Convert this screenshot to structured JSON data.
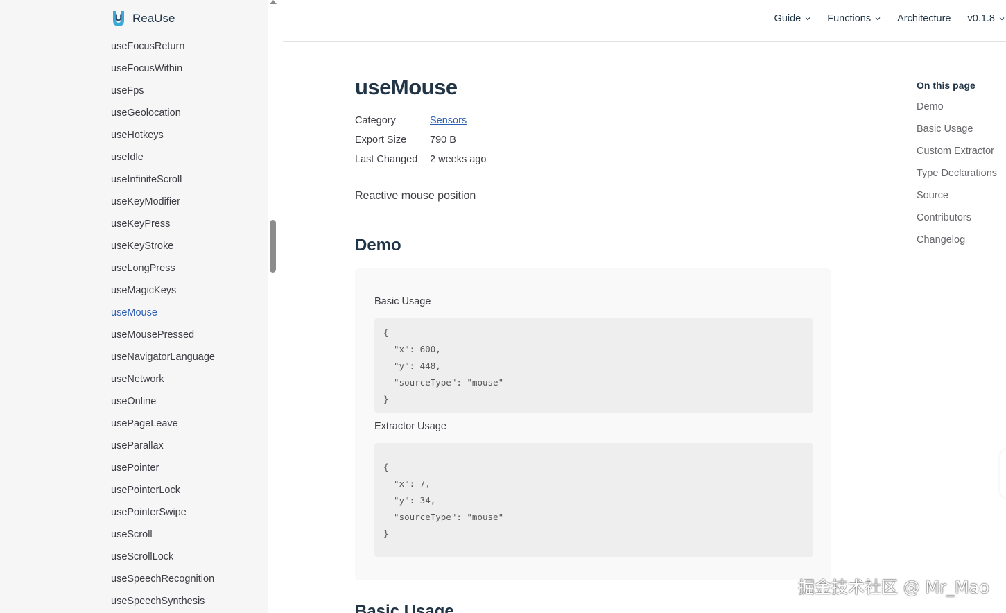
{
  "brand": {
    "name": "ReaUse",
    "logo_letter": "U"
  },
  "sidebar": {
    "items": [
      "useFocusReturn",
      "useFocusWithin",
      "useFps",
      "useGeolocation",
      "useHotkeys",
      "useIdle",
      "useInfiniteScroll",
      "useKeyModifier",
      "useKeyPress",
      "useKeyStroke",
      "useLongPress",
      "useMagicKeys",
      "useMouse",
      "useMousePressed",
      "useNavigatorLanguage",
      "useNetwork",
      "useOnline",
      "usePageLeave",
      "useParallax",
      "usePointer",
      "usePointerLock",
      "usePointerSwipe",
      "useScroll",
      "useScrollLock",
      "useSpeechRecognition",
      "useSpeechSynthesis"
    ],
    "active": "useMouse"
  },
  "nav": {
    "guide": "Guide",
    "functions": "Functions",
    "architecture": "Architecture",
    "version": "v0.1.8"
  },
  "page": {
    "title": "useMouse",
    "meta": {
      "category_label": "Category",
      "category_value": "Sensors",
      "size_label": "Export Size",
      "size_value": "790 B",
      "changed_label": "Last Changed",
      "changed_value": "2 weeks ago"
    },
    "description": "Reactive mouse position",
    "demo_heading": "Demo",
    "basic_label": "Basic Usage",
    "basic_code": [
      "{",
      "  \"x\": 600,",
      "  \"y\": 448,",
      "  \"sourceType\": \"mouse\"",
      "}"
    ],
    "extractor_label": "Extractor Usage",
    "extractor_code": [
      "{",
      "  \"x\": 7,",
      "  \"y\": 34,",
      "  \"sourceType\": \"mouse\"",
      "}"
    ],
    "next_heading": "Basic Usage"
  },
  "outline": {
    "title": "On this page",
    "items": [
      "Demo",
      "Basic Usage",
      "Custom Extractor",
      "Type Declarations",
      "Source",
      "Contributors",
      "Changelog"
    ]
  },
  "watermark": "掘金技术社区 @ Mr_Mao",
  "colors": {
    "accent": "#2f5fb3",
    "logo": "#3aa8d8"
  }
}
